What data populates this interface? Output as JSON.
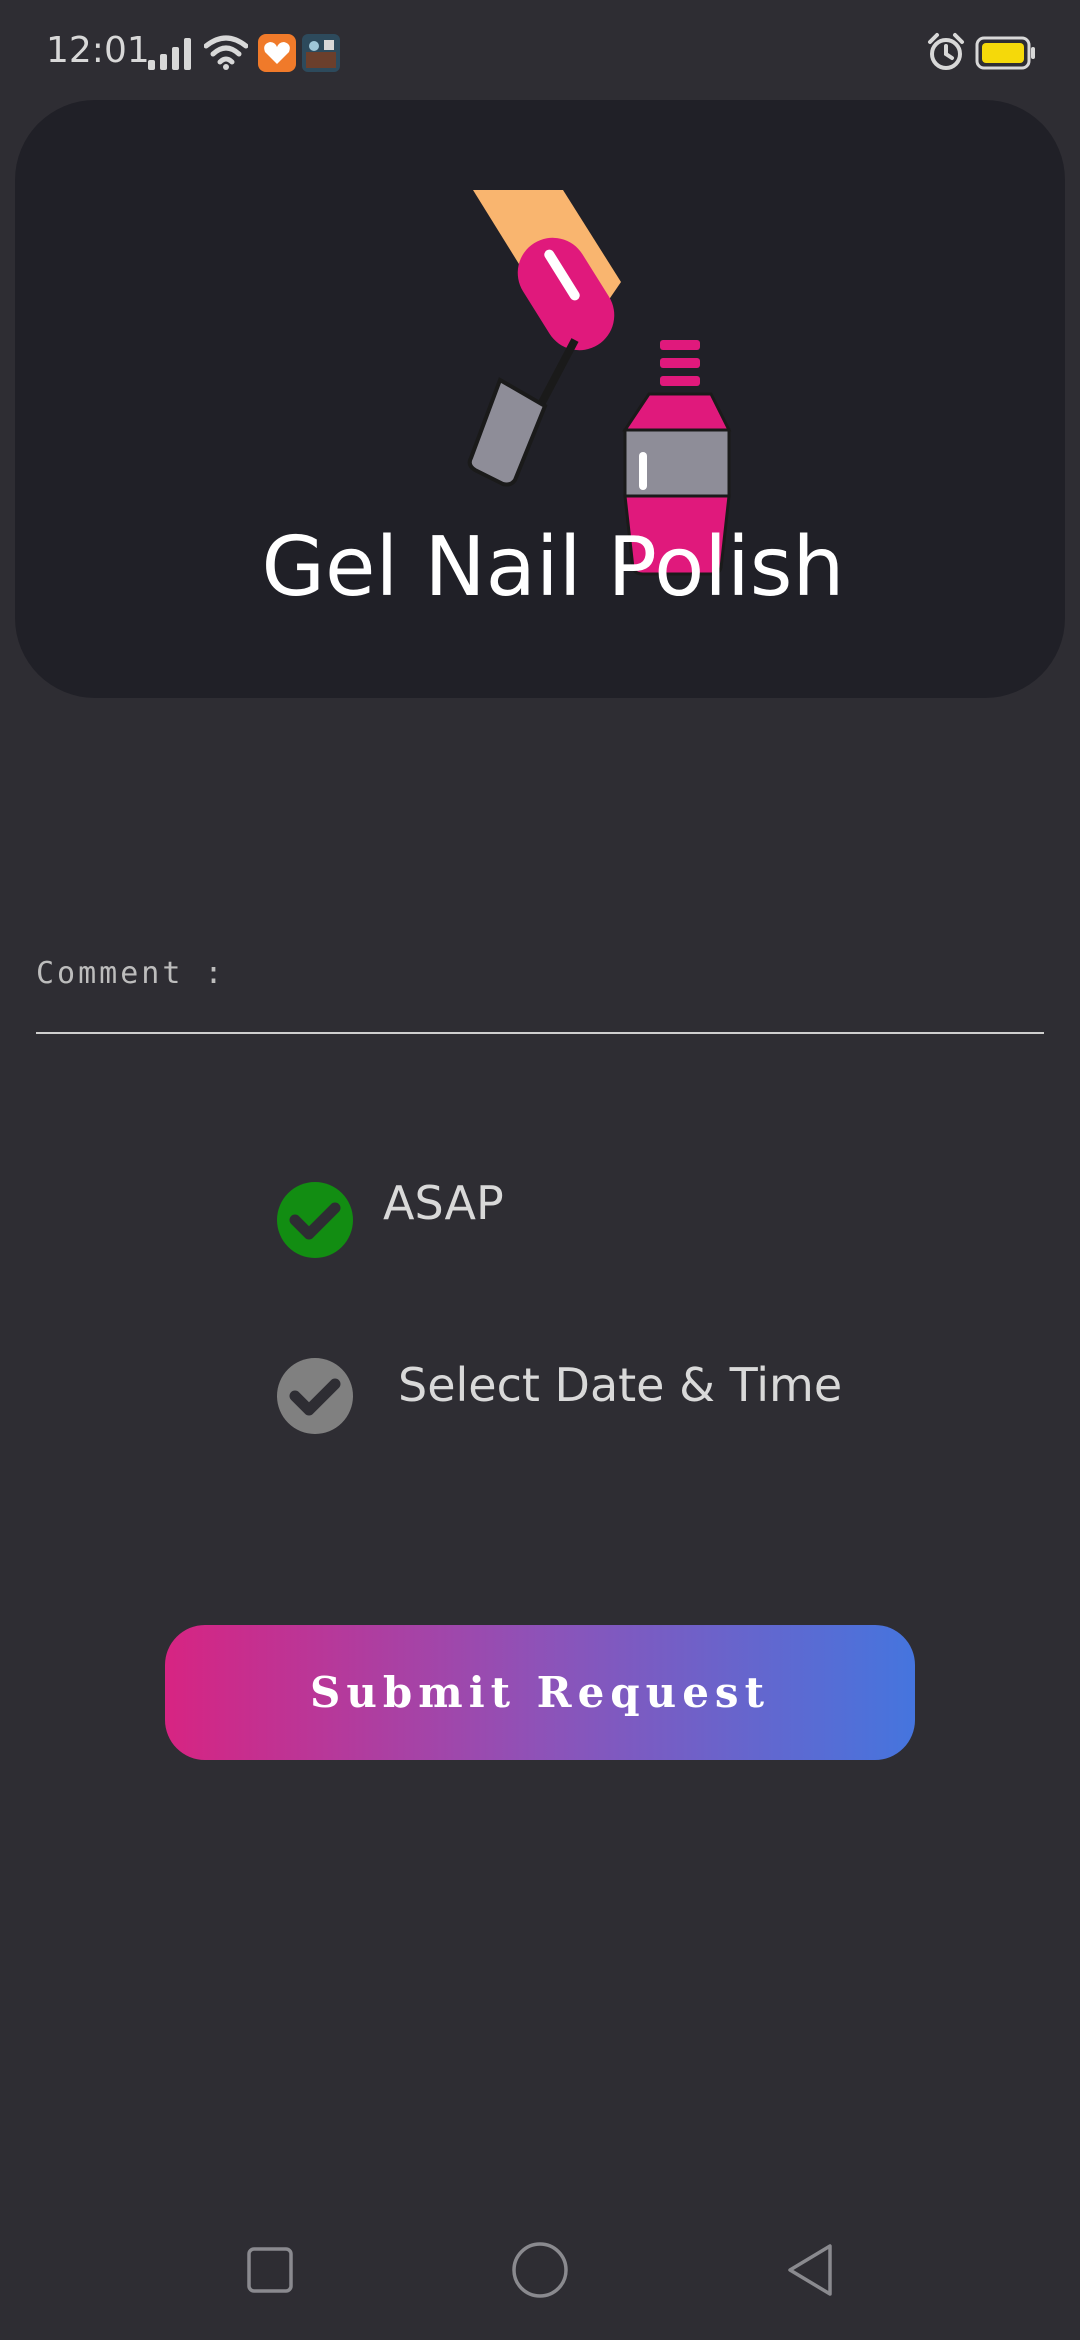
{
  "status_bar": {
    "time": "12:01",
    "icons": [
      "signal-icon",
      "wifi-icon",
      "health-app-icon",
      "gallery-app-icon",
      "alarm-icon",
      "battery-icon"
    ],
    "battery_color": "#f5d90a"
  },
  "header": {
    "title": "Gel Nail Polish",
    "art_icon": "nail-polish-icon",
    "colors": {
      "card": "#202027",
      "accent_pink": "#e0197c",
      "skin": "#f9b56f",
      "gray": "#8e8d98"
    }
  },
  "form": {
    "comment_label": "Comment :",
    "options": [
      {
        "label": "ASAP",
        "selected": true,
        "color": "#128d12"
      },
      {
        "label": "Select Date & Time",
        "selected": false,
        "color": "#808080"
      }
    ],
    "submit_label": "Submit Request",
    "submit_gradient": [
      "#d72482",
      "#8e52b8",
      "#4575de"
    ]
  },
  "nav": {
    "items": [
      "recent-apps-icon",
      "home-icon",
      "back-icon"
    ]
  }
}
